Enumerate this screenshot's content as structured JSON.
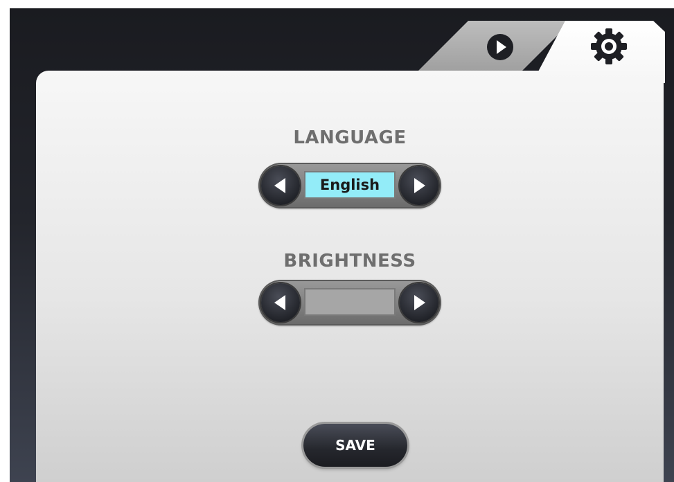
{
  "tabs": [
    {
      "id": "play",
      "icon": "play-icon",
      "active": false
    },
    {
      "id": "settings",
      "icon": "gear-icon",
      "active": true
    }
  ],
  "language": {
    "label": "LANGUAGE",
    "value": "English",
    "value_bg": "#93ecf8"
  },
  "brightness": {
    "label": "BRIGHTNESS",
    "value": ""
  },
  "save_label": "SAVE"
}
